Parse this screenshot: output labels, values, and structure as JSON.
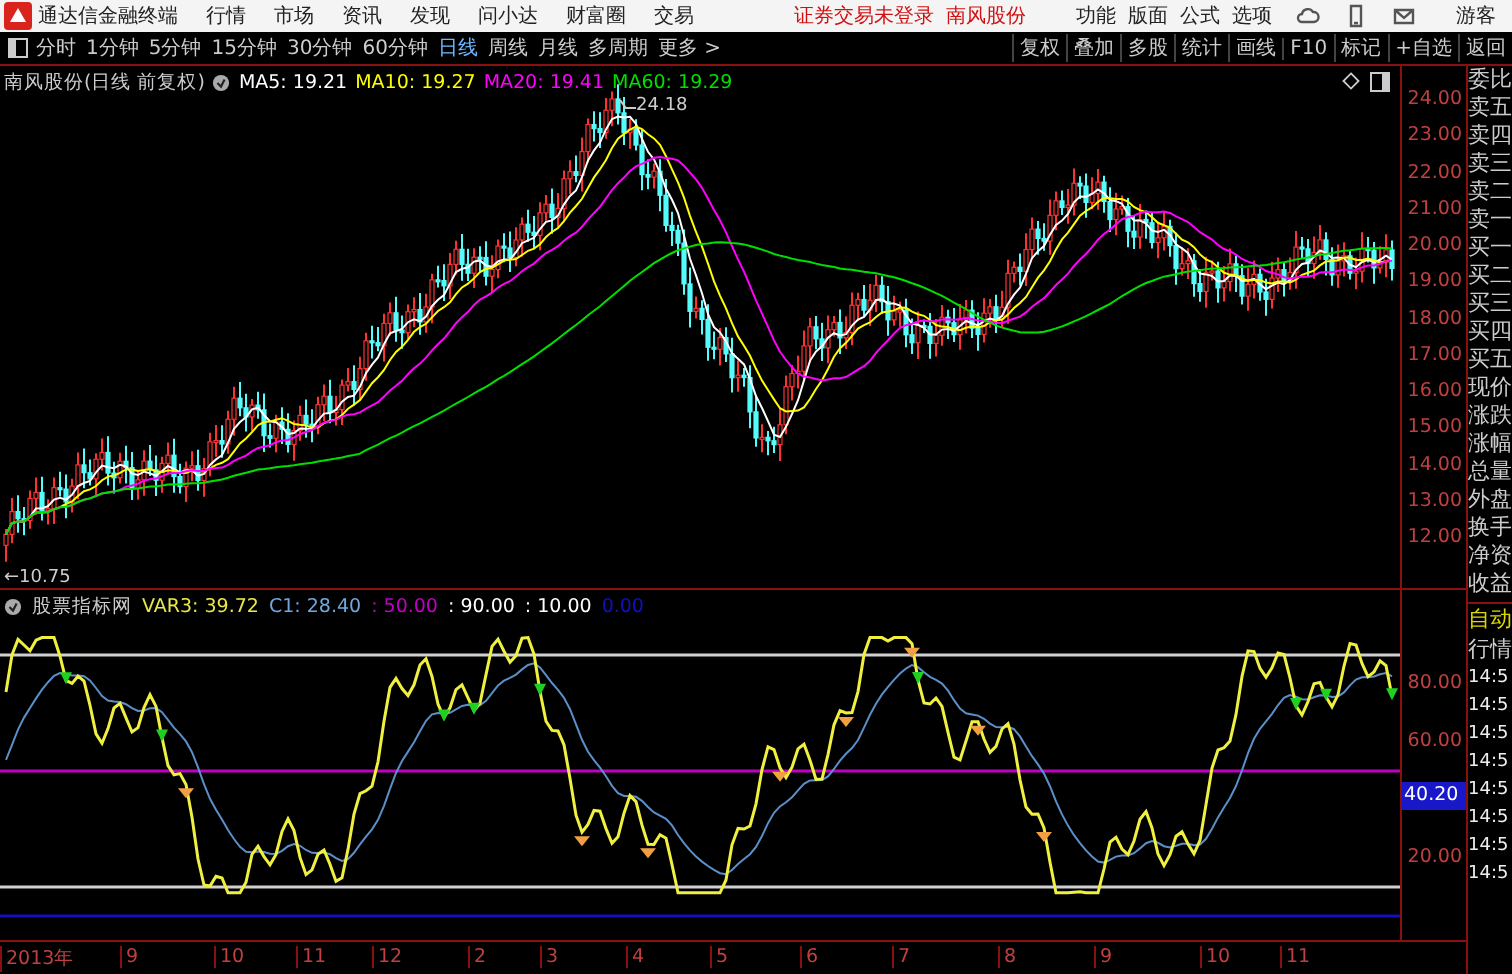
{
  "app_bar": {
    "title": "通达信金融终端",
    "menu": [
      "行情",
      "市场",
      "资讯",
      "发现",
      "问小达",
      "财富圈",
      "交易"
    ],
    "login_status": "证券交易未登录",
    "stock_name": "南风股份",
    "tools": [
      "功能",
      "版面",
      "公式",
      "选项"
    ],
    "user": "游客"
  },
  "toolbar": {
    "periods": [
      {
        "label": "分时",
        "selected": false
      },
      {
        "label": "1分钟",
        "selected": false
      },
      {
        "label": "5分钟",
        "selected": false
      },
      {
        "label": "15分钟",
        "selected": false
      },
      {
        "label": "30分钟",
        "selected": false
      },
      {
        "label": "60分钟",
        "selected": false
      },
      {
        "label": "日线",
        "selected": true
      },
      {
        "label": "周线",
        "selected": false
      },
      {
        "label": "月线",
        "selected": false
      },
      {
        "label": "多周期",
        "selected": false
      },
      {
        "label": "更多 >",
        "selected": false
      }
    ],
    "actions": [
      "复权",
      "叠加",
      "多股",
      "统计",
      "画线",
      "F10",
      "标记",
      "+自选",
      "返回"
    ]
  },
  "price_chart": {
    "title": "南风股份(日线 前复权)",
    "moving_averages": [
      {
        "text": "MA5: 19.21",
        "color": "#ffffff"
      },
      {
        "text": "MA10: 19.27",
        "color": "#ffff00"
      },
      {
        "text": "MA20: 19.41",
        "color": "#ff00ff"
      },
      {
        "text": "MA60: 19.29",
        "color": "#00e000"
      }
    ],
    "axis_labels": [
      "24.00",
      "23.00",
      "22.00",
      "21.00",
      "20.00",
      "19.00",
      "18.00",
      "17.00",
      "16.00",
      "15.00",
      "14.00",
      "13.00",
      "12.00"
    ],
    "high_label": "24.18",
    "low_label": "←10.75"
  },
  "indicator": {
    "title": "股票指标网",
    "values": [
      {
        "text": "VAR3: 39.72",
        "color": "#e8e84a"
      },
      {
        "text": "C1: 28.40",
        "color": "#6fa8dc"
      },
      {
        "text": ": 50.00",
        "color": "#c000c0"
      },
      {
        "text": ": 90.00",
        "color": "#ffffff"
      },
      {
        "text": ": 10.00",
        "color": "#ffffff"
      },
      {
        "text": "0.00",
        "color": "#1010c0"
      }
    ],
    "axis_labels": [
      "80.00",
      "60.00",
      "20.00"
    ],
    "current_value": "40.20"
  },
  "x_axis": [
    "2013年",
    "9",
    "10",
    "11",
    "12",
    "2",
    "3",
    "4",
    "5",
    "6",
    "7",
    "8",
    "9",
    "10",
    "11"
  ],
  "quote_panel": {
    "fields": [
      "委比",
      "卖五",
      "卖四",
      "卖三",
      "卖二",
      "卖一",
      "买一",
      "买二",
      "买三",
      "买四",
      "买五",
      "现价",
      "涨跌",
      "涨幅",
      "总量",
      "外盘",
      "换手",
      "净资",
      "收益"
    ],
    "mode": "自动",
    "tab": "行情",
    "times": [
      "14:5",
      "14:5",
      "14:5",
      "14:5",
      "14:5",
      "14:5",
      "14:5",
      "14:5"
    ]
  }
}
